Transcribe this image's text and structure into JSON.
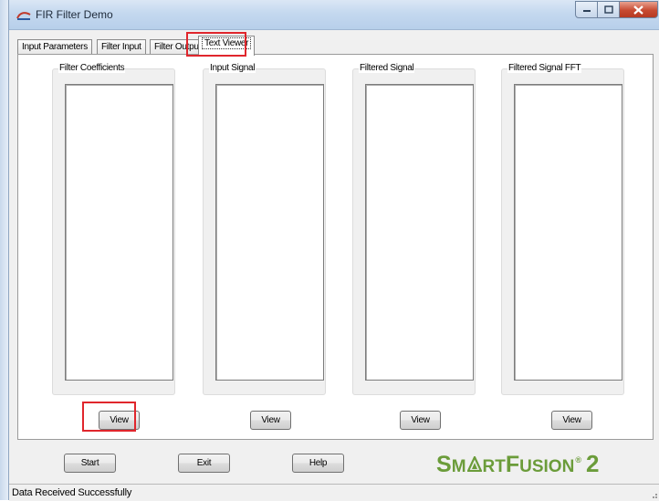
{
  "window": {
    "title": "FIR Filter Demo"
  },
  "tabs": [
    {
      "label": "Input Parameters"
    },
    {
      "label": "Filter Input"
    },
    {
      "label": "Filter Output"
    },
    {
      "label": "Text Viewer"
    }
  ],
  "groups": [
    {
      "label": "Filter Coefficients",
      "button": "View"
    },
    {
      "label": "Input Signal",
      "button": "View"
    },
    {
      "label": "Filtered Signal",
      "button": "View"
    },
    {
      "label": "Filtered Signal FFT",
      "button": "View"
    }
  ],
  "bottom": {
    "start_label": "Start",
    "exit_label": "Exit",
    "help_label": "Help"
  },
  "logo": {
    "part1": "S",
    "part2": "M",
    "part3": "RT",
    "part4": "F",
    "part5": "USION",
    "reg": "®",
    "part6": "2"
  },
  "status": {
    "text": "Data Received Successfully"
  },
  "colors": {
    "highlight": "#e0262c",
    "logo": "#6b9c3a"
  }
}
